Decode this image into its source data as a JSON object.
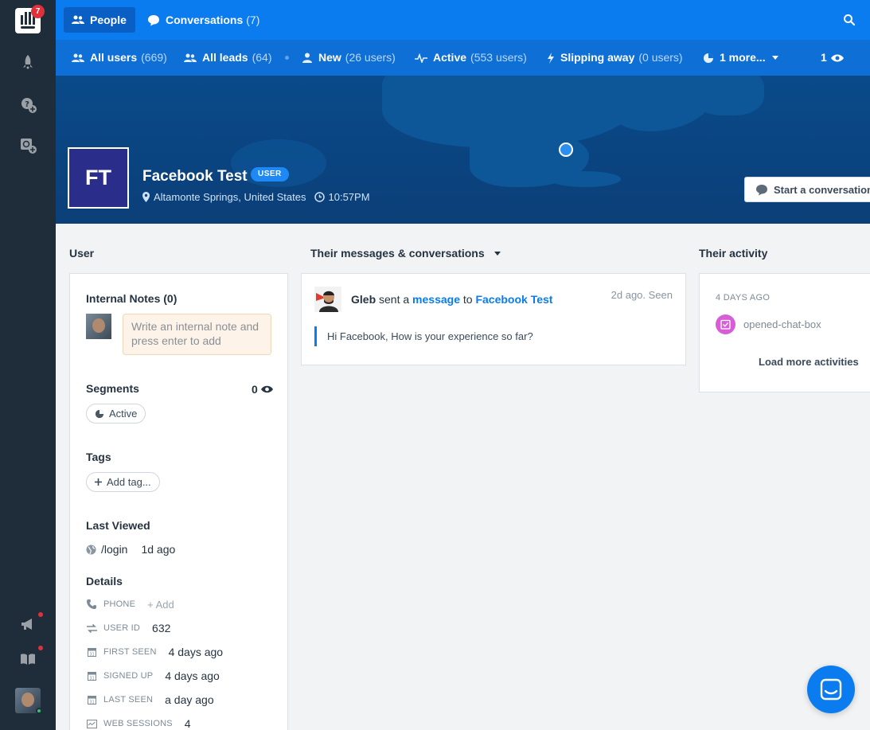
{
  "rail": {
    "logo_badge": "7",
    "icons": [
      "rocket-icon",
      "help-add-icon",
      "search-add-icon",
      "megaphone-icon",
      "book-icon"
    ]
  },
  "topnav": {
    "tabs": [
      {
        "label": "People",
        "count": "",
        "icon": "people-icon",
        "active": true
      },
      {
        "label": "Conversations",
        "count": "(7)",
        "icon": "chat-bubble-icon",
        "active": false
      }
    ]
  },
  "segments": [
    {
      "label": "All users",
      "count": "(669)",
      "icon": "people-icon"
    },
    {
      "label": "All leads",
      "count": "(64)",
      "icon": "people-icon"
    },
    {
      "label": "New",
      "count": "(26 users)",
      "icon": "person-icon"
    },
    {
      "label": "Active",
      "count": "(553 users)",
      "icon": "pulse-icon"
    },
    {
      "label": "Slipping away",
      "count": "(0 users)",
      "icon": "bolt-icon"
    },
    {
      "label": "1 more...",
      "count": "",
      "icon": "pie-icon"
    }
  ],
  "segbar_view_count": "1",
  "profile": {
    "initials": "FT",
    "name": "Facebook Test",
    "badge": "USER",
    "location": "Altamonte Springs, United States",
    "local_time": "10:57PM",
    "start_conversation": "Start a conversation"
  },
  "columns": {
    "user": "User",
    "messages": "Their messages & conversations",
    "activity": "Their activity"
  },
  "user_card": {
    "notes_title": "Internal Notes (0)",
    "note_placeholder": "Write an internal note and press enter to add",
    "segments_title": "Segments",
    "segments_count": "0",
    "segment_pill": "Active",
    "tags_title": "Tags",
    "add_tag": "Add tag...",
    "last_viewed_title": "Last Viewed",
    "last_viewed_path": "/login",
    "last_viewed_when": "1d ago",
    "details_title": "Details",
    "details": [
      {
        "label": "PHONE",
        "value": "",
        "add": "+ Add",
        "icon": "phone-icon"
      },
      {
        "label": "USER ID",
        "value": "632",
        "add": "",
        "icon": "swap-icon"
      },
      {
        "label": "FIRST SEEN",
        "value": "4 days ago",
        "add": "",
        "icon": "calendar-icon"
      },
      {
        "label": "SIGNED UP",
        "value": "4 days ago",
        "add": "",
        "icon": "calendar-icon"
      },
      {
        "label": "LAST SEEN",
        "value": "a day ago",
        "add": "",
        "icon": "calendar-icon"
      },
      {
        "label": "WEB SESSIONS",
        "value": "4",
        "add": "",
        "icon": "browser-icon"
      }
    ]
  },
  "message": {
    "sender": "Gleb",
    "sent_a": "sent a",
    "message_link": "message",
    "to": "to",
    "recipient": "Facebook Test",
    "time": "2d ago. Seen",
    "body": "Hi Facebook, How is your experience so far?"
  },
  "activity": {
    "label": "4 DAYS AGO",
    "event": "opened-chat-box",
    "load_more": "Load more activities"
  },
  "colors": {
    "primary": "#0a7cf0",
    "rail": "#1f2d3a",
    "hero": "#0b3f78",
    "avatar": "#2b2d8a",
    "activity_icon": "#d65fd6"
  }
}
